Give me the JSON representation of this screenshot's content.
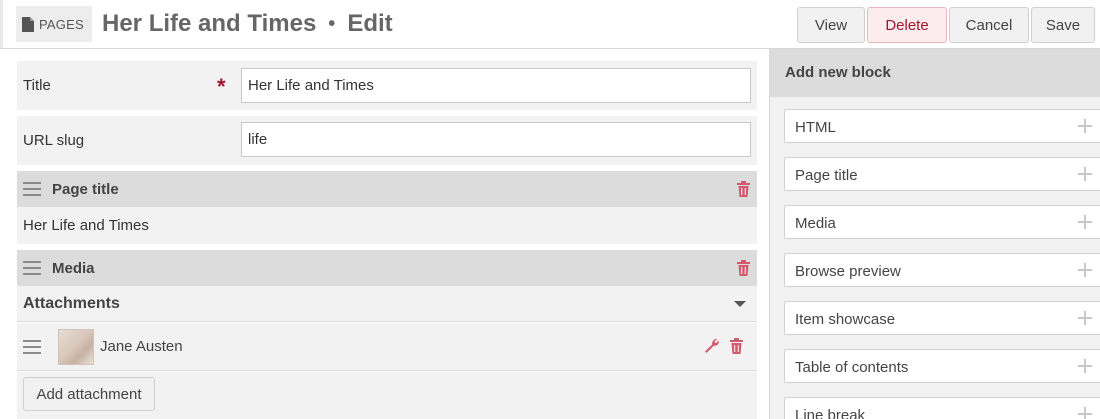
{
  "header": {
    "breadcrumb_label": "PAGES",
    "breadcrumb_icon": "document-icon",
    "page_title": "Her Life and Times",
    "separator": "•",
    "mode": "Edit",
    "buttons": {
      "view": "View",
      "delete": "Delete",
      "cancel": "Cancel",
      "save": "Save"
    }
  },
  "form": {
    "title_label": "Title",
    "required_marker": "*",
    "title_value": "Her Life and Times",
    "slug_label": "URL slug",
    "slug_value": "life"
  },
  "blocks": [
    {
      "type_label": "Page title",
      "content": "Her Life and Times"
    },
    {
      "type_label": "Media",
      "attachments_heading": "Attachments",
      "attachments": [
        {
          "name": "Jane Austen"
        }
      ],
      "add_attachment_label": "Add attachment"
    }
  ],
  "sidebar": {
    "heading": "Add new block",
    "block_types": [
      "HTML",
      "Page title",
      "Media",
      "Browse preview",
      "Item showcase",
      "Table of contents",
      "Line break"
    ]
  },
  "colors": {
    "danger": "#a3142e",
    "trash": "#d05a6e",
    "bar": "#dcdcdc",
    "panel": "#f2f2f2"
  }
}
